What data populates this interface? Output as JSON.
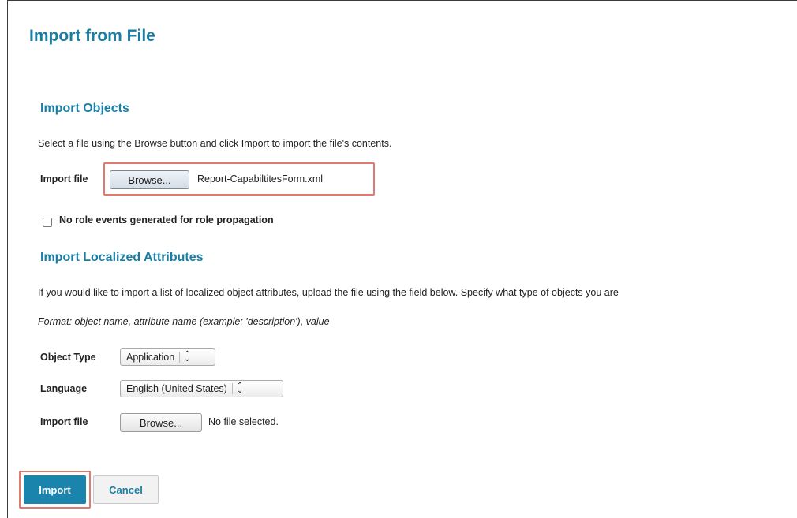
{
  "page": {
    "title": "Import from File"
  },
  "import_objects": {
    "heading": "Import Objects",
    "description": "Select a file using the Browse button and click Import to import the file's contents.",
    "file_label": "Import file",
    "browse_label": "Browse...",
    "selected_file": "Report-CapabiltitesForm.xml",
    "checkbox_label": "No role events generated for role propagation",
    "checkbox_checked": false
  },
  "import_localized": {
    "heading": "Import Localized Attributes",
    "description": "If you would like to import a list of localized object attributes, upload the file using the field below. Specify what type of objects you are",
    "format_hint": "Format: object name, attribute name (example: 'description'), value",
    "object_type_label": "Object Type",
    "object_type_value": "Application",
    "language_label": "Language",
    "language_value": "English (United States)",
    "file_label": "Import file",
    "browse_label": "Browse...",
    "no_file_text": "No file selected."
  },
  "actions": {
    "import_label": "Import",
    "cancel_label": "Cancel"
  },
  "colors": {
    "accent": "#1a7ea4",
    "primary_button": "#1a84ad",
    "highlight": "#e07a6e"
  }
}
